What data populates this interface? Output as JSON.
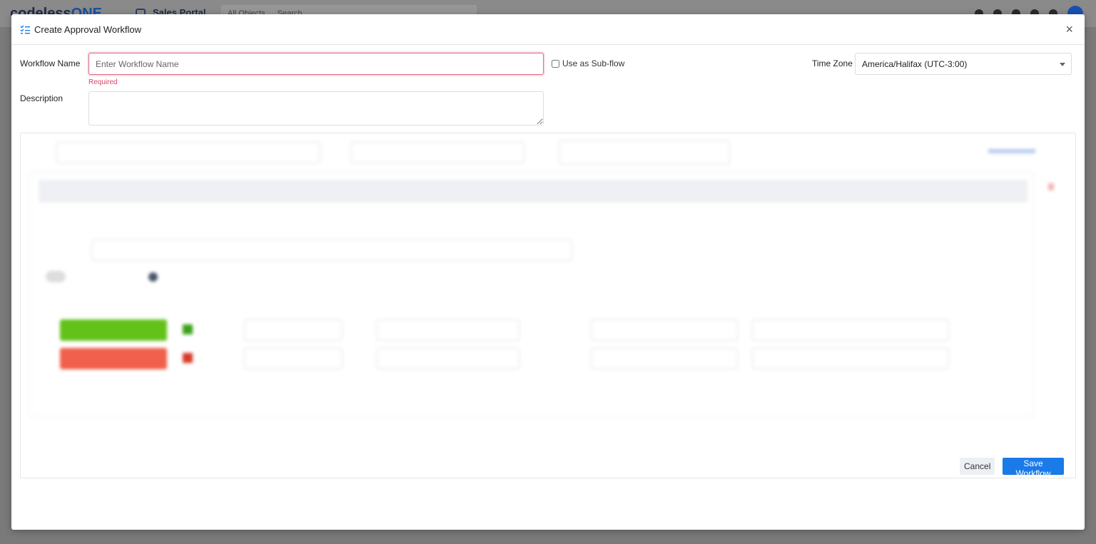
{
  "background": {
    "logo_text": "codeless",
    "logo_accent": "ONE",
    "portal_name": "Sales Portal",
    "search_scope": "All Objects",
    "search_placeholder": "Search"
  },
  "modal": {
    "title": "Create Approval Workflow",
    "close_label": "×",
    "workflow_name_label": "Workflow Name",
    "workflow_name_placeholder": "Enter Workflow Name",
    "workflow_name_value": "",
    "required_text": "Required",
    "subflow_label": "Use as Sub-flow",
    "subflow_checked": false,
    "timezone_label": "Time Zone",
    "timezone_value": "America/Halifax (UTC-3:00)",
    "description_label": "Description",
    "description_value": "",
    "cancel_label": "Cancel",
    "save_label": "Save Workflow"
  },
  "colors": {
    "accent": "#1a7ae8",
    "error": "#d9436a",
    "approve": "#62c21a",
    "reject": "#f0604c"
  }
}
